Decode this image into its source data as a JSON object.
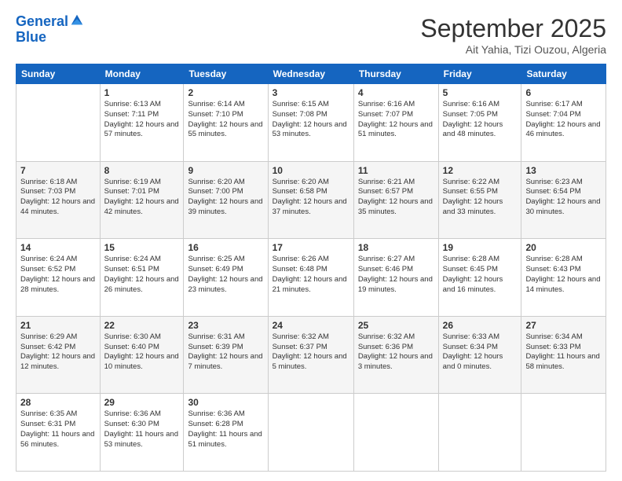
{
  "header": {
    "logo_line1": "General",
    "logo_line2": "Blue",
    "month_title": "September 2025",
    "location": "Ait Yahia, Tizi Ouzou, Algeria"
  },
  "days_of_week": [
    "Sunday",
    "Monday",
    "Tuesday",
    "Wednesday",
    "Thursday",
    "Friday",
    "Saturday"
  ],
  "weeks": [
    [
      {
        "day": "",
        "sunrise": "",
        "sunset": "",
        "daylight": ""
      },
      {
        "day": "1",
        "sunrise": "Sunrise: 6:13 AM",
        "sunset": "Sunset: 7:11 PM",
        "daylight": "Daylight: 12 hours and 57 minutes."
      },
      {
        "day": "2",
        "sunrise": "Sunrise: 6:14 AM",
        "sunset": "Sunset: 7:10 PM",
        "daylight": "Daylight: 12 hours and 55 minutes."
      },
      {
        "day": "3",
        "sunrise": "Sunrise: 6:15 AM",
        "sunset": "Sunset: 7:08 PM",
        "daylight": "Daylight: 12 hours and 53 minutes."
      },
      {
        "day": "4",
        "sunrise": "Sunrise: 6:16 AM",
        "sunset": "Sunset: 7:07 PM",
        "daylight": "Daylight: 12 hours and 51 minutes."
      },
      {
        "day": "5",
        "sunrise": "Sunrise: 6:16 AM",
        "sunset": "Sunset: 7:05 PM",
        "daylight": "Daylight: 12 hours and 48 minutes."
      },
      {
        "day": "6",
        "sunrise": "Sunrise: 6:17 AM",
        "sunset": "Sunset: 7:04 PM",
        "daylight": "Daylight: 12 hours and 46 minutes."
      }
    ],
    [
      {
        "day": "7",
        "sunrise": "Sunrise: 6:18 AM",
        "sunset": "Sunset: 7:03 PM",
        "daylight": "Daylight: 12 hours and 44 minutes."
      },
      {
        "day": "8",
        "sunrise": "Sunrise: 6:19 AM",
        "sunset": "Sunset: 7:01 PM",
        "daylight": "Daylight: 12 hours and 42 minutes."
      },
      {
        "day": "9",
        "sunrise": "Sunrise: 6:20 AM",
        "sunset": "Sunset: 7:00 PM",
        "daylight": "Daylight: 12 hours and 39 minutes."
      },
      {
        "day": "10",
        "sunrise": "Sunrise: 6:20 AM",
        "sunset": "Sunset: 6:58 PM",
        "daylight": "Daylight: 12 hours and 37 minutes."
      },
      {
        "day": "11",
        "sunrise": "Sunrise: 6:21 AM",
        "sunset": "Sunset: 6:57 PM",
        "daylight": "Daylight: 12 hours and 35 minutes."
      },
      {
        "day": "12",
        "sunrise": "Sunrise: 6:22 AM",
        "sunset": "Sunset: 6:55 PM",
        "daylight": "Daylight: 12 hours and 33 minutes."
      },
      {
        "day": "13",
        "sunrise": "Sunrise: 6:23 AM",
        "sunset": "Sunset: 6:54 PM",
        "daylight": "Daylight: 12 hours and 30 minutes."
      }
    ],
    [
      {
        "day": "14",
        "sunrise": "Sunrise: 6:24 AM",
        "sunset": "Sunset: 6:52 PM",
        "daylight": "Daylight: 12 hours and 28 minutes."
      },
      {
        "day": "15",
        "sunrise": "Sunrise: 6:24 AM",
        "sunset": "Sunset: 6:51 PM",
        "daylight": "Daylight: 12 hours and 26 minutes."
      },
      {
        "day": "16",
        "sunrise": "Sunrise: 6:25 AM",
        "sunset": "Sunset: 6:49 PM",
        "daylight": "Daylight: 12 hours and 23 minutes."
      },
      {
        "day": "17",
        "sunrise": "Sunrise: 6:26 AM",
        "sunset": "Sunset: 6:48 PM",
        "daylight": "Daylight: 12 hours and 21 minutes."
      },
      {
        "day": "18",
        "sunrise": "Sunrise: 6:27 AM",
        "sunset": "Sunset: 6:46 PM",
        "daylight": "Daylight: 12 hours and 19 minutes."
      },
      {
        "day": "19",
        "sunrise": "Sunrise: 6:28 AM",
        "sunset": "Sunset: 6:45 PM",
        "daylight": "Daylight: 12 hours and 16 minutes."
      },
      {
        "day": "20",
        "sunrise": "Sunrise: 6:28 AM",
        "sunset": "Sunset: 6:43 PM",
        "daylight": "Daylight: 12 hours and 14 minutes."
      }
    ],
    [
      {
        "day": "21",
        "sunrise": "Sunrise: 6:29 AM",
        "sunset": "Sunset: 6:42 PM",
        "daylight": "Daylight: 12 hours and 12 minutes."
      },
      {
        "day": "22",
        "sunrise": "Sunrise: 6:30 AM",
        "sunset": "Sunset: 6:40 PM",
        "daylight": "Daylight: 12 hours and 10 minutes."
      },
      {
        "day": "23",
        "sunrise": "Sunrise: 6:31 AM",
        "sunset": "Sunset: 6:39 PM",
        "daylight": "Daylight: 12 hours and 7 minutes."
      },
      {
        "day": "24",
        "sunrise": "Sunrise: 6:32 AM",
        "sunset": "Sunset: 6:37 PM",
        "daylight": "Daylight: 12 hours and 5 minutes."
      },
      {
        "day": "25",
        "sunrise": "Sunrise: 6:32 AM",
        "sunset": "Sunset: 6:36 PM",
        "daylight": "Daylight: 12 hours and 3 minutes."
      },
      {
        "day": "26",
        "sunrise": "Sunrise: 6:33 AM",
        "sunset": "Sunset: 6:34 PM",
        "daylight": "Daylight: 12 hours and 0 minutes."
      },
      {
        "day": "27",
        "sunrise": "Sunrise: 6:34 AM",
        "sunset": "Sunset: 6:33 PM",
        "daylight": "Daylight: 11 hours and 58 minutes."
      }
    ],
    [
      {
        "day": "28",
        "sunrise": "Sunrise: 6:35 AM",
        "sunset": "Sunset: 6:31 PM",
        "daylight": "Daylight: 11 hours and 56 minutes."
      },
      {
        "day": "29",
        "sunrise": "Sunrise: 6:36 AM",
        "sunset": "Sunset: 6:30 PM",
        "daylight": "Daylight: 11 hours and 53 minutes."
      },
      {
        "day": "30",
        "sunrise": "Sunrise: 6:36 AM",
        "sunset": "Sunset: 6:28 PM",
        "daylight": "Daylight: 11 hours and 51 minutes."
      },
      {
        "day": "",
        "sunrise": "",
        "sunset": "",
        "daylight": ""
      },
      {
        "day": "",
        "sunrise": "",
        "sunset": "",
        "daylight": ""
      },
      {
        "day": "",
        "sunrise": "",
        "sunset": "",
        "daylight": ""
      },
      {
        "day": "",
        "sunrise": "",
        "sunset": "",
        "daylight": ""
      }
    ]
  ]
}
